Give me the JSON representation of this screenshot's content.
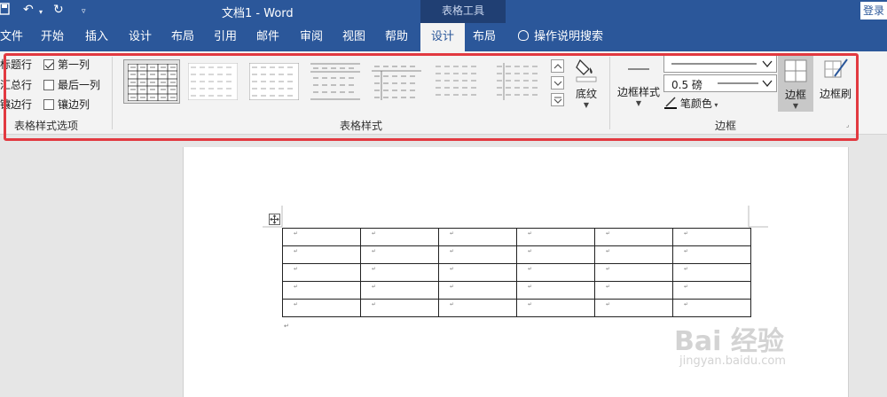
{
  "titlebar": {
    "doc_title": "文档1 - Word",
    "context_title": "表格工具",
    "login": "登录",
    "qa_undo": "↶",
    "qa_redo": "↻"
  },
  "tabs": {
    "file": "文件",
    "home": "开始",
    "insert": "插入",
    "design": "设计",
    "layout": "布局",
    "references": "引用",
    "mailings": "邮件",
    "review": "审阅",
    "view": "视图",
    "help": "帮助",
    "table_design": "设计",
    "table_layout": "布局",
    "tell_me": "操作说明搜索"
  },
  "style_options": {
    "header_row": "标题行",
    "total_row": "汇总行",
    "banded_rows": "镶边行",
    "first_column": "第一列",
    "last_column": "最后一列",
    "banded_columns": "镶边列",
    "first_column_checked": true,
    "group_label": "表格样式选项"
  },
  "table_styles": {
    "group_label": "表格样式",
    "shading_label": "底纹"
  },
  "borders": {
    "border_styles_label": "边框样式",
    "line_weight": "0.5 磅",
    "pen_color_label": "笔颜色",
    "borders_label": "边框",
    "border_painter_label": "边框刷",
    "group_label": "边框"
  },
  "document": {
    "rows": 5,
    "cols": 6,
    "cell_mark": "↵",
    "para_mark": "↵"
  },
  "watermark": {
    "main": "Bai 经验",
    "sub": "jingyan.baidu.com"
  },
  "colors": {
    "accent": "#2b579a",
    "highlight": "#e23940",
    "ribbon_bg": "#f3f3f3"
  }
}
